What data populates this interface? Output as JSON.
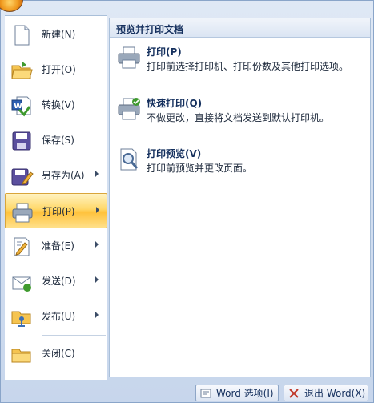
{
  "panel": {
    "header": "预览并打印文档",
    "options": [
      {
        "title": "打印(P)",
        "desc": "打印前选择打印机、打印份数及其他打印选项。",
        "icon": "printer-icon"
      },
      {
        "title": "快速打印(Q)",
        "desc": "不做更改，直接将文档发送到默认打印机。",
        "icon": "quick-print-icon"
      },
      {
        "title": "打印预览(V)",
        "desc": "打印前预览并更改页面。",
        "icon": "print-preview-icon"
      }
    ]
  },
  "menu": {
    "items": [
      {
        "label": "新建(N)",
        "icon": "new-document-icon",
        "submenu": false
      },
      {
        "label": "打开(O)",
        "icon": "open-folder-icon",
        "submenu": false
      },
      {
        "label": "转换(V)",
        "icon": "convert-icon",
        "submenu": false
      },
      {
        "label": "保存(S)",
        "icon": "save-icon",
        "submenu": false
      },
      {
        "label": "另存为(A)",
        "icon": "save-as-icon",
        "submenu": true
      },
      {
        "label": "打印(P)",
        "icon": "print-icon",
        "submenu": true,
        "selected": true
      },
      {
        "label": "准备(E)",
        "icon": "prepare-icon",
        "submenu": true
      },
      {
        "label": "发送(D)",
        "icon": "send-icon",
        "submenu": true
      },
      {
        "label": "发布(U)",
        "icon": "publish-icon",
        "submenu": true
      },
      {
        "label": "关闭(C)",
        "icon": "close-folder-icon",
        "submenu": false
      }
    ]
  },
  "bottom": {
    "options_label": "Word 选项(I)",
    "exit_label": "退出 Word(X)"
  },
  "colors": {
    "selected": "#ffd869",
    "panel_header": "#dbe5f3",
    "text": "#15305e"
  }
}
